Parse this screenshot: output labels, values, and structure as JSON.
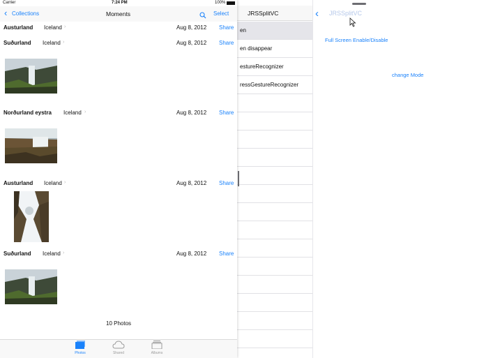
{
  "status_bar": {
    "carrier": "Carrier",
    "time": "7:24 PM",
    "battery": "100%"
  },
  "photos_nav": {
    "back_label": "Collections",
    "title": "Moments",
    "select_label": "Select"
  },
  "moments": [
    {
      "title": "Austurland",
      "country": "Iceland",
      "date": "Aug 8, 2012",
      "share": "Share"
    },
    {
      "title": "Suðurland",
      "country": "Iceland",
      "date": "Aug 8, 2012",
      "share": "Share"
    },
    {
      "title": "Norðurland eystra",
      "country": "Iceland",
      "date": "Aug 8, 2012",
      "share": "Share"
    },
    {
      "title": "Austurland",
      "country": "Iceland",
      "date": "Aug 8, 2012",
      "share": "Share"
    },
    {
      "title": "Suðurland",
      "country": "Iceland",
      "date": "Aug 8, 2012",
      "share": "Share"
    }
  ],
  "photo_count": "10 Photos",
  "tabs": [
    {
      "label": "Photos",
      "active": true
    },
    {
      "label": "Shared",
      "active": false
    },
    {
      "label": "Albums",
      "active": false
    }
  ],
  "master": {
    "title": "JRSSplitVC",
    "rows": [
      "en",
      "en disappear",
      "estureRecognizer",
      "ressGestureRecognizer"
    ]
  },
  "detail": {
    "title": "JRSSplitVC",
    "full_screen_link": "Full Screen Enable/Disable",
    "change_mode_link": "change Mode"
  },
  "colors": {
    "accent": "#1a82fb",
    "selected_row": "#e5e5ea"
  },
  "icons": [
    "chevron-left-icon",
    "search-icon",
    "photos-tab-icon",
    "cloud-icon",
    "albums-icon",
    "cursor-icon"
  ]
}
